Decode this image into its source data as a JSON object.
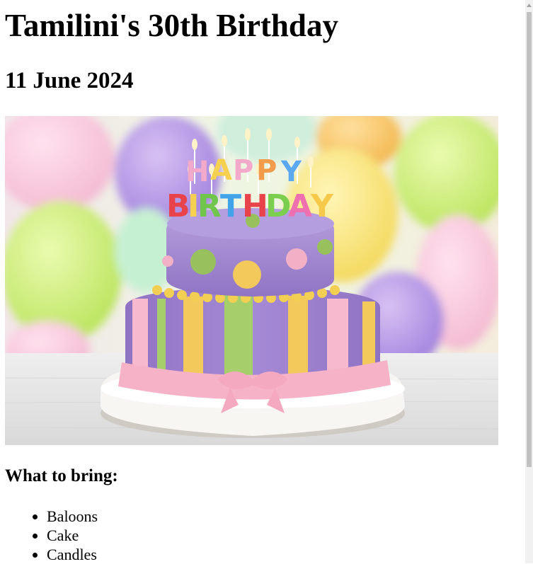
{
  "page": {
    "title": "Tamilini's 30th Birthday",
    "date": "11 June 2024",
    "bring_heading": "What to bring:",
    "items": [
      "Baloons",
      "Cake",
      "Candles"
    ]
  },
  "image": {
    "subject": "birthday-cake-photo",
    "candle_text": "HAPPY BIRTHDAY"
  },
  "colors": {
    "cake_purple": "#a98fd0",
    "cake_green": "#9cc96a",
    "cake_yellow": "#f2c95a",
    "cake_pink": "#f4b7c9",
    "plate": "#f5f3ef"
  }
}
